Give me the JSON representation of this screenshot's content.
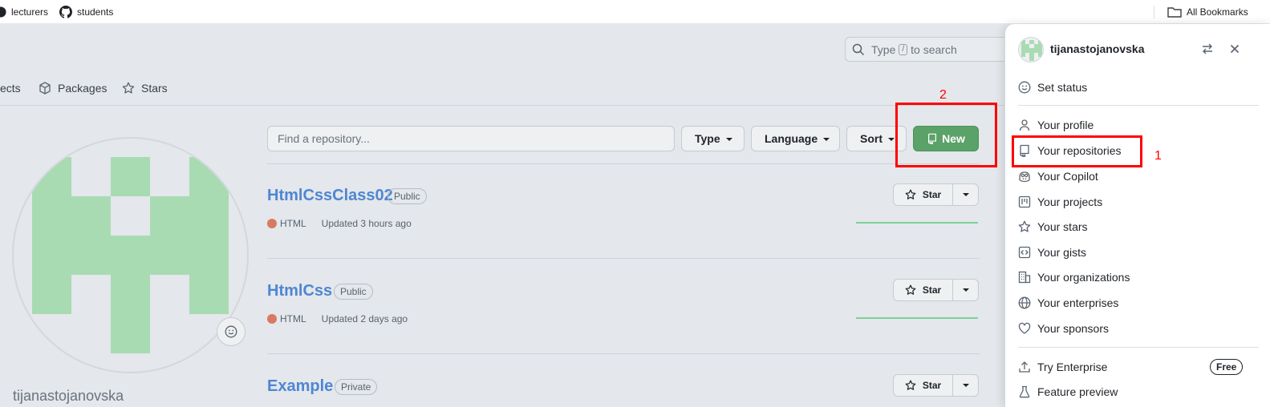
{
  "bookmarks": {
    "items": [
      {
        "label": "lecturers"
      },
      {
        "label": "students"
      }
    ],
    "all_bookmarks": "All Bookmarks"
  },
  "header": {
    "search": {
      "prefix": "Type",
      "slash": "/",
      "suffix": "to search"
    }
  },
  "profile_tabs": [
    {
      "label": "ects",
      "icon": "table-icon"
    },
    {
      "label": "Packages",
      "icon": "package-icon"
    },
    {
      "label": "Stars",
      "icon": "star-icon"
    }
  ],
  "profile": {
    "username": "tijanastojanovska"
  },
  "toolbar": {
    "find_placeholder": "Find a repository...",
    "type_label": "Type",
    "language_label": "Language",
    "sort_label": "Sort",
    "new_label": "New"
  },
  "repos": [
    {
      "name": "HtmlCssClass02",
      "visibility": "Public",
      "language": "HTML",
      "updated": "Updated 3 hours ago",
      "star_label": "Star"
    },
    {
      "name": "HtmlCss",
      "visibility": "Public",
      "language": "HTML",
      "updated": "Updated 2 days ago",
      "star_label": "Star"
    },
    {
      "name": "Example",
      "visibility": "Private",
      "star_label": "Star"
    }
  ],
  "annotations": {
    "first": "1",
    "second": "2",
    "color": "#ff0000"
  },
  "user_menu": {
    "username": "tijanastojanovska",
    "items": [
      {
        "label": "Set status",
        "icon": "smiley-icon"
      },
      {
        "label": "Your profile",
        "icon": "person-icon"
      },
      {
        "label": "Your repositories",
        "icon": "repo-icon"
      },
      {
        "label": "Your Copilot",
        "icon": "copilot-icon"
      },
      {
        "label": "Your projects",
        "icon": "project-icon"
      },
      {
        "label": "Your stars",
        "icon": "star-icon"
      },
      {
        "label": "Your gists",
        "icon": "code-square-icon"
      },
      {
        "label": "Your organizations",
        "icon": "organization-icon"
      },
      {
        "label": "Your enterprises",
        "icon": "globe-icon"
      },
      {
        "label": "Your sponsors",
        "icon": "heart-icon"
      },
      {
        "label": "Try Enterprise",
        "icon": "upload-icon",
        "badge": "Free"
      },
      {
        "label": "Feature preview",
        "icon": "beaker-icon"
      }
    ]
  },
  "colors": {
    "accent_green": "#5aa268",
    "link_blue": "#4e86d4",
    "html_dot": "#d77a61",
    "identicon": "#a9dbb3"
  }
}
